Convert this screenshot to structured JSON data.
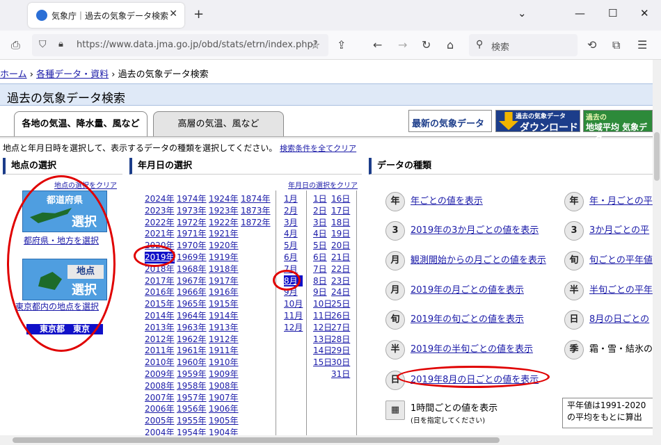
{
  "browser": {
    "tab_title": "気象庁｜過去の気象データ検索",
    "url": "https://www.data.jma.go.jp/obd/stats/etrn/index.php?",
    "search_placeholder": "検索"
  },
  "breadcrumb": {
    "home": "ホーム",
    "sep1": "›",
    "data": "各種データ・資料",
    "sep2": "›",
    "current": "過去の気象データ検索"
  },
  "page_title": "過去の気象データ検索",
  "tabs": [
    {
      "label": "各地の気温、降水量、風など"
    },
    {
      "label": "高層の気温、風など"
    }
  ],
  "banners": {
    "latest": "最新の気象データ",
    "download_top": "過去の気象データ",
    "download": "ダウンロード",
    "avg_top": "過去の",
    "avg": "地域平均 気象データ"
  },
  "instruction": "地点と年月日時を選択して、表示するデータの種類を選択してください。",
  "clear_all": "検索条件を全てクリア",
  "location": {
    "heading": "地点の選択",
    "clear": "地点の選択をクリア",
    "pref_btn_top": "都道府県",
    "pref_btn_sel": "選択",
    "pref_link": "都府県・地方を選択",
    "point_btn_top": "地点",
    "point_btn_sel": "選択",
    "point_link": "東京都内の地点を選択",
    "selected": "東京都　東京"
  },
  "date": {
    "heading": "年月日の選択",
    "clear": "年月日の選択をクリア",
    "years_col1": [
      "2024年",
      "2023年",
      "2022年",
      "2021年",
      "2020年",
      "2019年",
      "2018年",
      "2017年",
      "2016年",
      "2015年",
      "2014年",
      "2013年",
      "2012年",
      "2011年",
      "2010年",
      "2009年",
      "2008年",
      "2007年",
      "2006年",
      "2005年",
      "2004年"
    ],
    "years_col2": [
      "1974年",
      "1973年",
      "1972年",
      "1971年",
      "1970年",
      "1969年",
      "1968年",
      "1967年",
      "1966年",
      "1965年",
      "1964年",
      "1963年",
      "1962年",
      "1961年",
      "1960年",
      "1959年",
      "1958年",
      "1957年",
      "1956年",
      "1955年",
      "1954年"
    ],
    "years_col3": [
      "1924年",
      "1923年",
      "1922年",
      "1921年",
      "1920年",
      "1919年",
      "1918年",
      "1917年",
      "1916年",
      "1915年",
      "1914年",
      "1913年",
      "1912年",
      "1911年",
      "1910年",
      "1909年",
      "1908年",
      "1907年",
      "1906年",
      "1905年",
      "1904年"
    ],
    "years_col4": [
      "1874年",
      "1873年",
      "1872年"
    ],
    "selected_year": "2019年",
    "months": [
      "1月",
      "2月",
      "3月",
      "4月",
      "5月",
      "6月",
      "7月",
      "8月",
      "9月",
      "10月",
      "11月",
      "12月"
    ],
    "selected_month": "8月",
    "days_col1": [
      "1日",
      "2日",
      "3日",
      "4日",
      "5日",
      "6日",
      "7日",
      "8日",
      "9日",
      "10日",
      "11日",
      "12日",
      "13日",
      "14日",
      "15日"
    ],
    "days_col2": [
      "16日",
      "17日",
      "18日",
      "19日",
      "20日",
      "21日",
      "22日",
      "23日",
      "24日",
      "25日",
      "26日",
      "27日",
      "28日",
      "29日",
      "30日",
      "31日"
    ]
  },
  "data_types": {
    "heading": "データの種類",
    "left": [
      {
        "icon": "年",
        "label": "年ごとの値を表示"
      },
      {
        "icon": "3",
        "label": "2019年の3か月ごとの値を表示"
      },
      {
        "icon": "月",
        "label": "観測開始からの月ごとの値を表示"
      },
      {
        "icon": "月",
        "label": "2019年の月ごとの値を表示"
      },
      {
        "icon": "旬",
        "label": "2019年の旬ごとの値を表示"
      },
      {
        "icon": "半",
        "label": "2019年の半旬ごとの値を表示"
      },
      {
        "icon": "日",
        "label": "2019年8月の日ごとの値を表示"
      }
    ],
    "right": [
      {
        "icon": "年",
        "label": "年・月ごとの平"
      },
      {
        "icon": "3",
        "label": "3か月ごとの平"
      },
      {
        "icon": "旬",
        "label": "旬ごとの平年値"
      },
      {
        "icon": "半",
        "label": "半旬ごとの平年"
      },
      {
        "icon": "日",
        "label": "8月の日ごとの"
      },
      {
        "icon": "季",
        "label": "霜・雪・結氷の"
      }
    ],
    "hourly": "1時間ごとの値を表示",
    "hourly_sub": "(日を指定してください)",
    "normal_note1": "平年値は1991-2020",
    "normal_note2": "の平均をもとに算出"
  },
  "accent_color": "#e00000"
}
